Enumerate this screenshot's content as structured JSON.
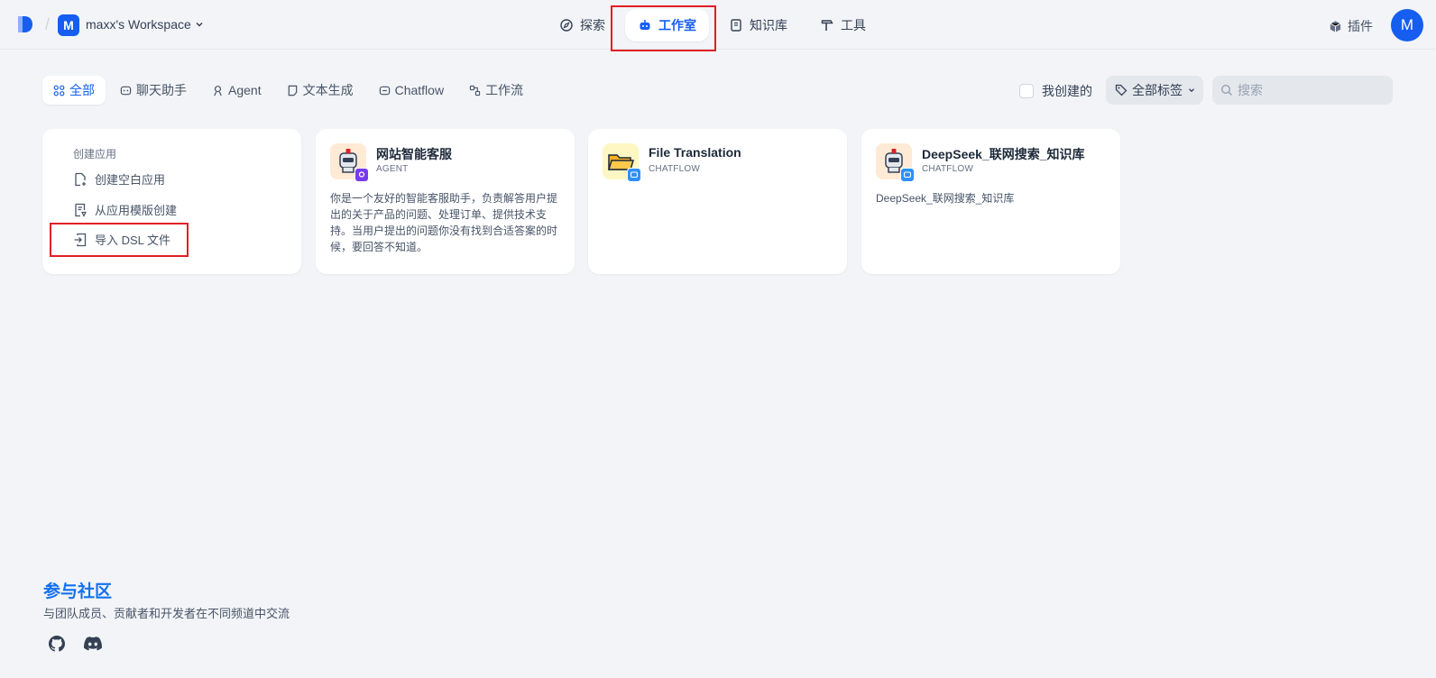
{
  "header": {
    "workspace_initial": "M",
    "workspace_name": "maxx's Workspace",
    "nav": [
      {
        "label": "探索",
        "icon": "compass-icon"
      },
      {
        "label": "工作室",
        "icon": "robot-icon"
      },
      {
        "label": "知识库",
        "icon": "book-icon"
      },
      {
        "label": "工具",
        "icon": "hammer-icon"
      }
    ],
    "plugin_label": "插件",
    "avatar_initial": "M"
  },
  "filters": {
    "tabs": [
      {
        "label": "全部"
      },
      {
        "label": "聊天助手"
      },
      {
        "label": "Agent"
      },
      {
        "label": "文本生成"
      },
      {
        "label": "Chatflow"
      },
      {
        "label": "工作流"
      }
    ],
    "mine_label": "我创建的",
    "tags_label": "全部标签",
    "search_placeholder": "搜索"
  },
  "create": {
    "title": "创建应用",
    "items": [
      {
        "label": "创建空白应用"
      },
      {
        "label": "从应用模版创建"
      },
      {
        "label": "导入 DSL 文件"
      }
    ]
  },
  "apps": [
    {
      "name": "网站智能客服",
      "type": "AGENT",
      "description": "你是一个友好的智能客服助手，负责解答用户提出的关于产品的问题、处理订单、提供技术支持。当用户提出的问题你没有找到合适答案的时候，要回答不知道。"
    },
    {
      "name": "File Translation",
      "type": "CHATFLOW",
      "description": ""
    },
    {
      "name": "DeepSeek_联网搜索_知识库",
      "type": "CHATFLOW",
      "description": "DeepSeek_联网搜索_知识库"
    }
  ],
  "community": {
    "title": "参与社区",
    "description": "与团队成员、贡献者和开发者在不同频道中交流"
  },
  "colors": {
    "accent": "#155eef",
    "highlight": "#e01f26",
    "background": "#f2f4f7"
  }
}
